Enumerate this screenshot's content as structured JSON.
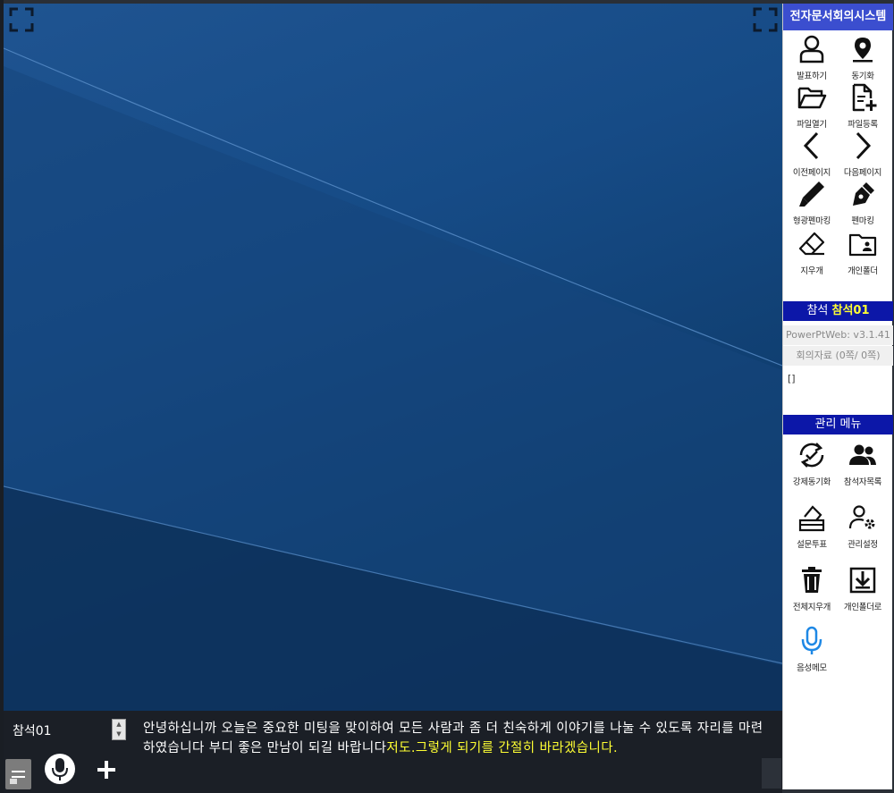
{
  "panel": {
    "title": "전자문서회의시스템",
    "tools": [
      {
        "name": "present",
        "label": "발표하기",
        "icon": "person-icon"
      },
      {
        "name": "sync",
        "label": "동기화",
        "icon": "location-pin-icon"
      },
      {
        "name": "open-file",
        "label": "파일열기",
        "icon": "folder-open-icon"
      },
      {
        "name": "register-file",
        "label": "파일등록",
        "icon": "file-add-icon"
      },
      {
        "name": "prev-page",
        "label": "이전페이지",
        "icon": "chevron-left-icon"
      },
      {
        "name": "next-page",
        "label": "다음페이지",
        "icon": "chevron-right-icon"
      },
      {
        "name": "highlighter",
        "label": "형광펜마킹",
        "icon": "highlighter-icon"
      },
      {
        "name": "pen",
        "label": "펜마킹",
        "icon": "pen-nib-icon"
      },
      {
        "name": "eraser",
        "label": "지우개",
        "icon": "eraser-icon"
      },
      {
        "name": "personal-folder",
        "label": "개인폴더",
        "icon": "folder-user-icon"
      }
    ],
    "attendee": {
      "prefix": "참석",
      "name": "참석01"
    },
    "version": "PowerPtWeb: v3.1.41",
    "materials": "회의자료 (0쪽/ 0쪽)",
    "raw": "[]",
    "admin": {
      "title": "관리 메뉴",
      "tools": [
        {
          "name": "force-sync",
          "label": "강제동기화",
          "icon": "sync-check-icon"
        },
        {
          "name": "attendee-list",
          "label": "참석자목록",
          "icon": "users-icon"
        },
        {
          "name": "survey-vote",
          "label": "설문투표",
          "icon": "ballot-box-icon"
        },
        {
          "name": "admin-settings",
          "label": "관리설정",
          "icon": "user-gear-icon"
        },
        {
          "name": "clear-all",
          "label": "전체지우개",
          "icon": "trash-icon"
        },
        {
          "name": "to-personal-folder",
          "label": "개인폴더로",
          "icon": "download-box-icon"
        },
        {
          "name": "voice-memo",
          "label": "음성메모",
          "icon": "microphone-icon"
        }
      ]
    }
  },
  "bottom": {
    "seat": "참석01",
    "transcript_white": "안녕하십니까 오늘은 중요한 미팅을 맞이하여 모든 사람과 좀 더 친숙하게 이야기를 나눌 수 있도록 자리를 마련하였습니다 부디 좋은 만남이 되길 바랍니다",
    "transcript_yellow": "저도.그렇게 되기를 간절히 바라겠습니다."
  },
  "colors": {
    "panel_title_bg": "#3b4ecf",
    "section_bg": "#0c17a8",
    "highlight_text": "#ffff33",
    "mic_accent": "#1e88e5"
  }
}
